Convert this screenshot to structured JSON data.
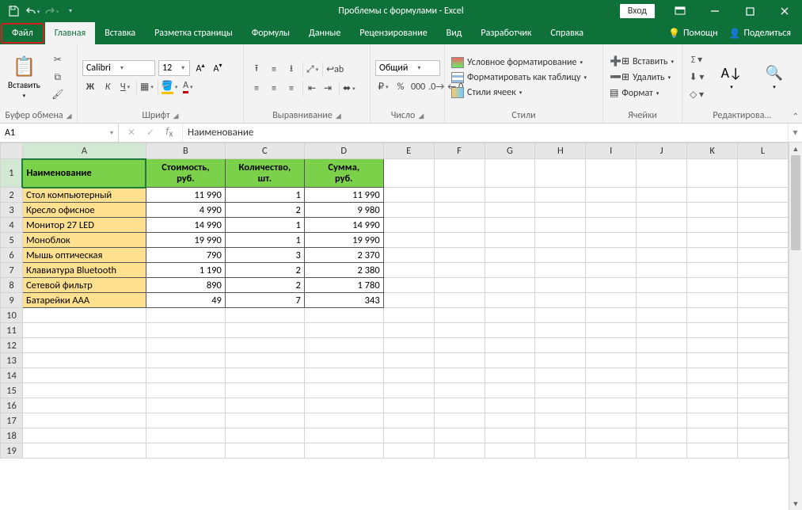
{
  "title": "Проблемы с формулами - Excel",
  "login": "Вход",
  "tabs": {
    "file": "Файл",
    "home": "Главная",
    "insert": "Вставка",
    "layout": "Разметка страницы",
    "formulas": "Формулы",
    "data": "Данные",
    "review": "Рецензирование",
    "view": "Вид",
    "developer": "Разработчик",
    "help": "Справка",
    "tellme": "Помощн",
    "share": "Поделиться"
  },
  "ribbon": {
    "paste": "Вставить",
    "clipboard": "Буфер обмена",
    "font_name": "Calibri",
    "font_size": "12",
    "font": "Шрифт",
    "alignment": "Выравнивание",
    "number_format": "Общий",
    "number": "Число",
    "cond_format": "Условное форматирование",
    "format_table": "Форматировать как таблицу",
    "cell_styles": "Стили ячеек",
    "styles": "Стили",
    "insert_cells": "Вставить",
    "delete_cells": "Удалить",
    "format_cells": "Формат",
    "cells": "Ячейки",
    "editing": "Редактирова..."
  },
  "namebox": "A1",
  "formula": "Наименование",
  "columns": [
    "A",
    "B",
    "C",
    "D",
    "E",
    "F",
    "G",
    "H",
    "I",
    "J",
    "K",
    "L"
  ],
  "headers": {
    "a": "Наименование",
    "b": "Стоимость, руб.",
    "c": "Количество, шт.",
    "d": "Сумма, руб."
  },
  "rows": [
    {
      "name": "Стол компьютерный",
      "cost": "11 990",
      "qty": "1",
      "sum": "11 990"
    },
    {
      "name": "Кресло офисное",
      "cost": "4 990",
      "qty": "2",
      "sum": "9 980"
    },
    {
      "name": "Монитор 27 LED",
      "cost": "14 990",
      "qty": "1",
      "sum": "14 990"
    },
    {
      "name": "Моноблок",
      "cost": "19 990",
      "qty": "1",
      "sum": "19 990"
    },
    {
      "name": "Мышь оптическая",
      "cost": "790",
      "qty": "3",
      "sum": "2 370"
    },
    {
      "name": "Клавиатура Bluetooth",
      "cost": "1 190",
      "qty": "2",
      "sum": "2 380"
    },
    {
      "name": "Сетевой фильтр",
      "cost": "890",
      "qty": "2",
      "sum": "1 780"
    },
    {
      "name": "Батарейки ААА",
      "cost": "49",
      "qty": "7",
      "sum": "343"
    }
  ]
}
